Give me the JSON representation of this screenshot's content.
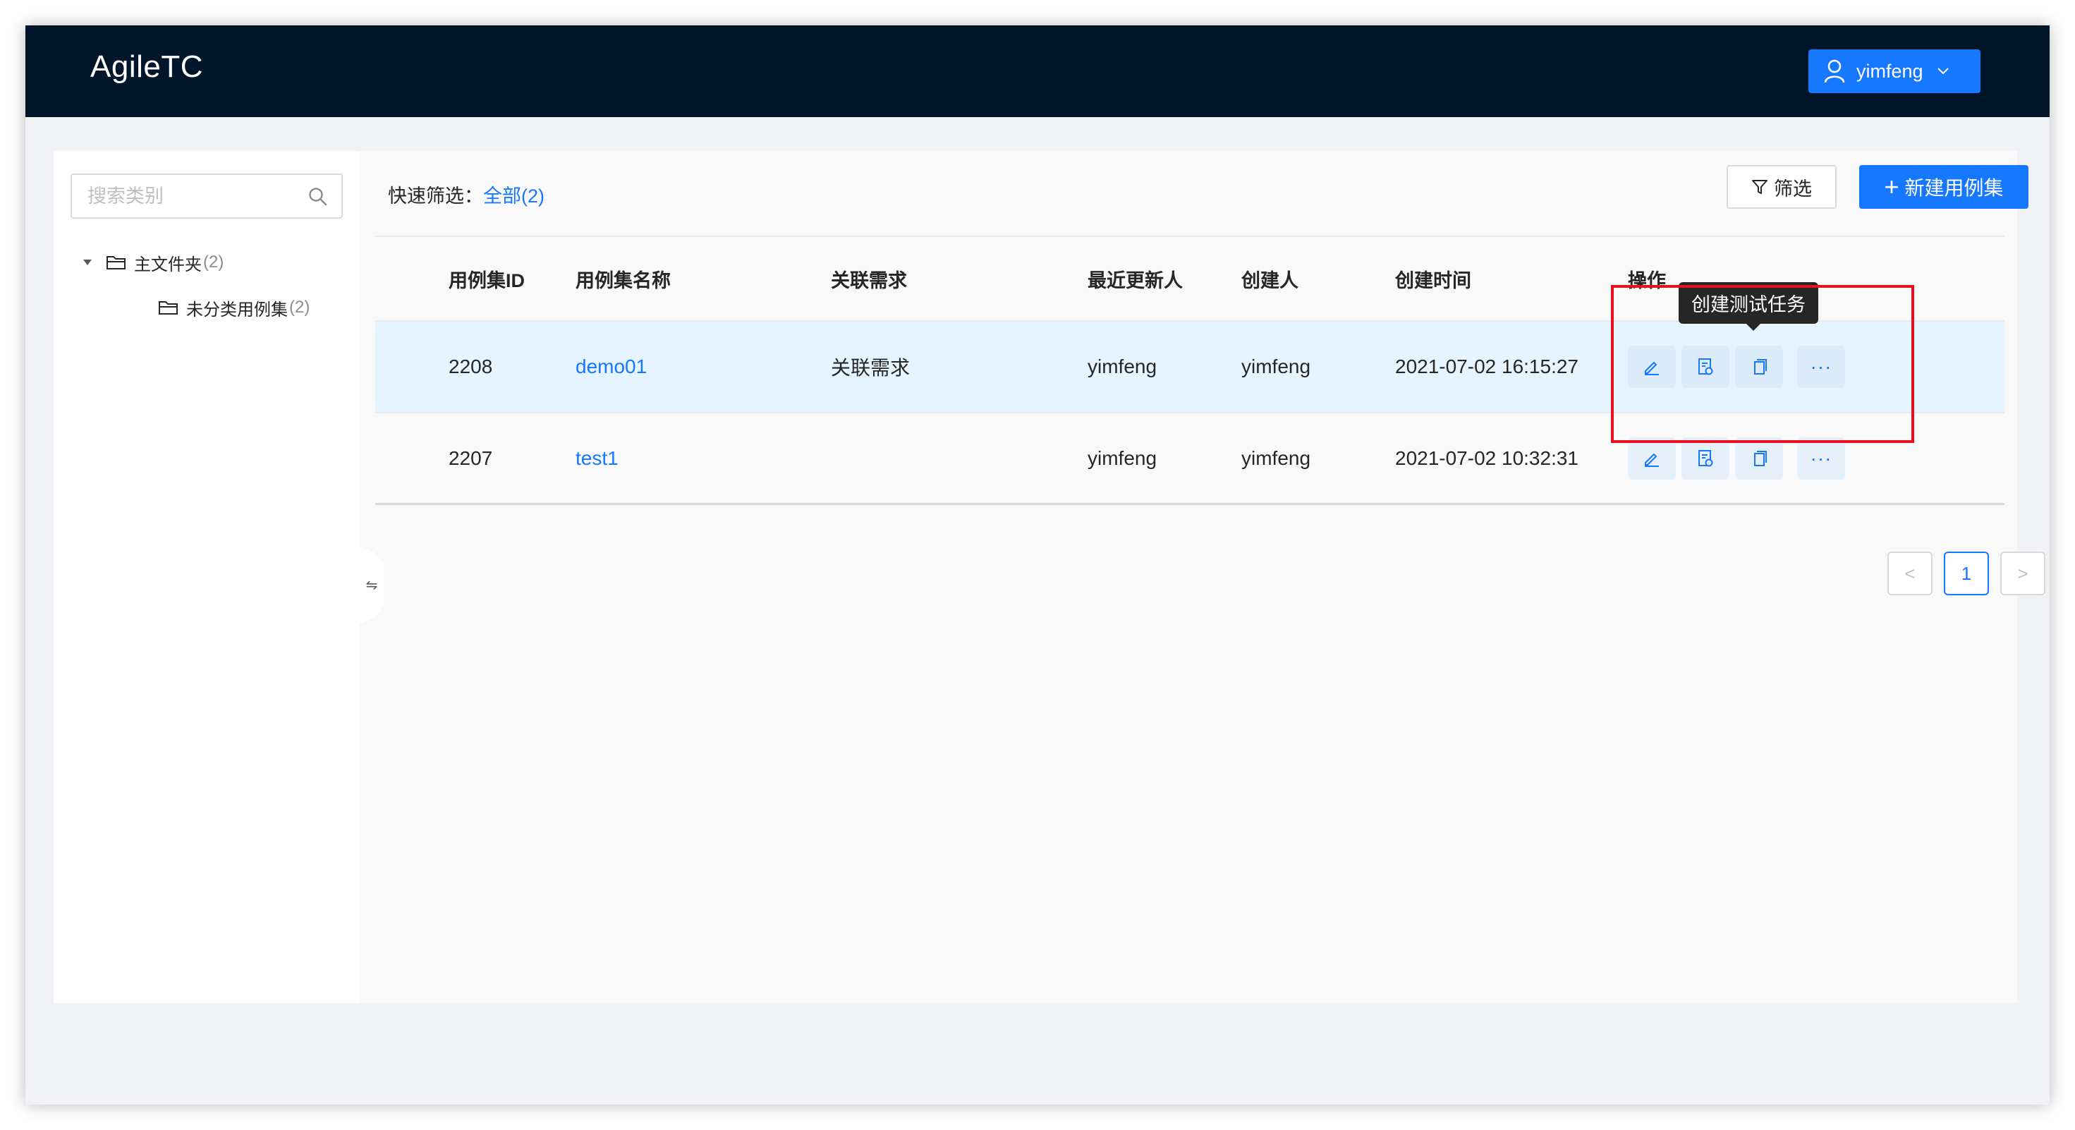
{
  "app": {
    "brand": "AgileTC",
    "user": {
      "name": "yimfeng",
      "icon": "user-icon"
    }
  },
  "sidebar": {
    "search_placeholder": "搜索类别",
    "tree": [
      {
        "label": "主文件夹",
        "count": "(2)",
        "expanded": true,
        "icon": "folder-icon"
      },
      {
        "label": "未分类用例集",
        "count": "(2)",
        "icon": "folder-icon"
      }
    ],
    "collapse_symbol": "⇋"
  },
  "toolbar": {
    "quick_filter_label": "快速筛选：",
    "quick_filter_value": "全部(2)",
    "filter_button": "筛选",
    "new_button": "新建用例集"
  },
  "table": {
    "columns": [
      "用例集ID",
      "用例集名称",
      "关联需求",
      "最近更新人",
      "创建人",
      "创建时间",
      "操作"
    ],
    "rows": [
      {
        "id": "2208",
        "name": "demo01",
        "requirement": "关联需求",
        "updater": "yimfeng",
        "creator": "yimfeng",
        "created": "2021-07-02 16:15:27",
        "highlighted": true
      },
      {
        "id": "2207",
        "name": "test1",
        "requirement": "",
        "updater": "yimfeng",
        "creator": "yimfeng",
        "created": "2021-07-02 10:32:31",
        "highlighted": false
      }
    ],
    "action_icons": [
      "edit-icon",
      "create-task-icon",
      "copy-icon",
      "more-icon"
    ],
    "more_symbol": "···",
    "tooltip": "创建测试任务"
  },
  "pagination": {
    "current": "1",
    "prev": "<",
    "next": ">"
  },
  "colors": {
    "header_bg": "#001529",
    "primary": "#1677ff",
    "highlight_row": "#e6f4ff",
    "annotation": "#e8101e"
  }
}
